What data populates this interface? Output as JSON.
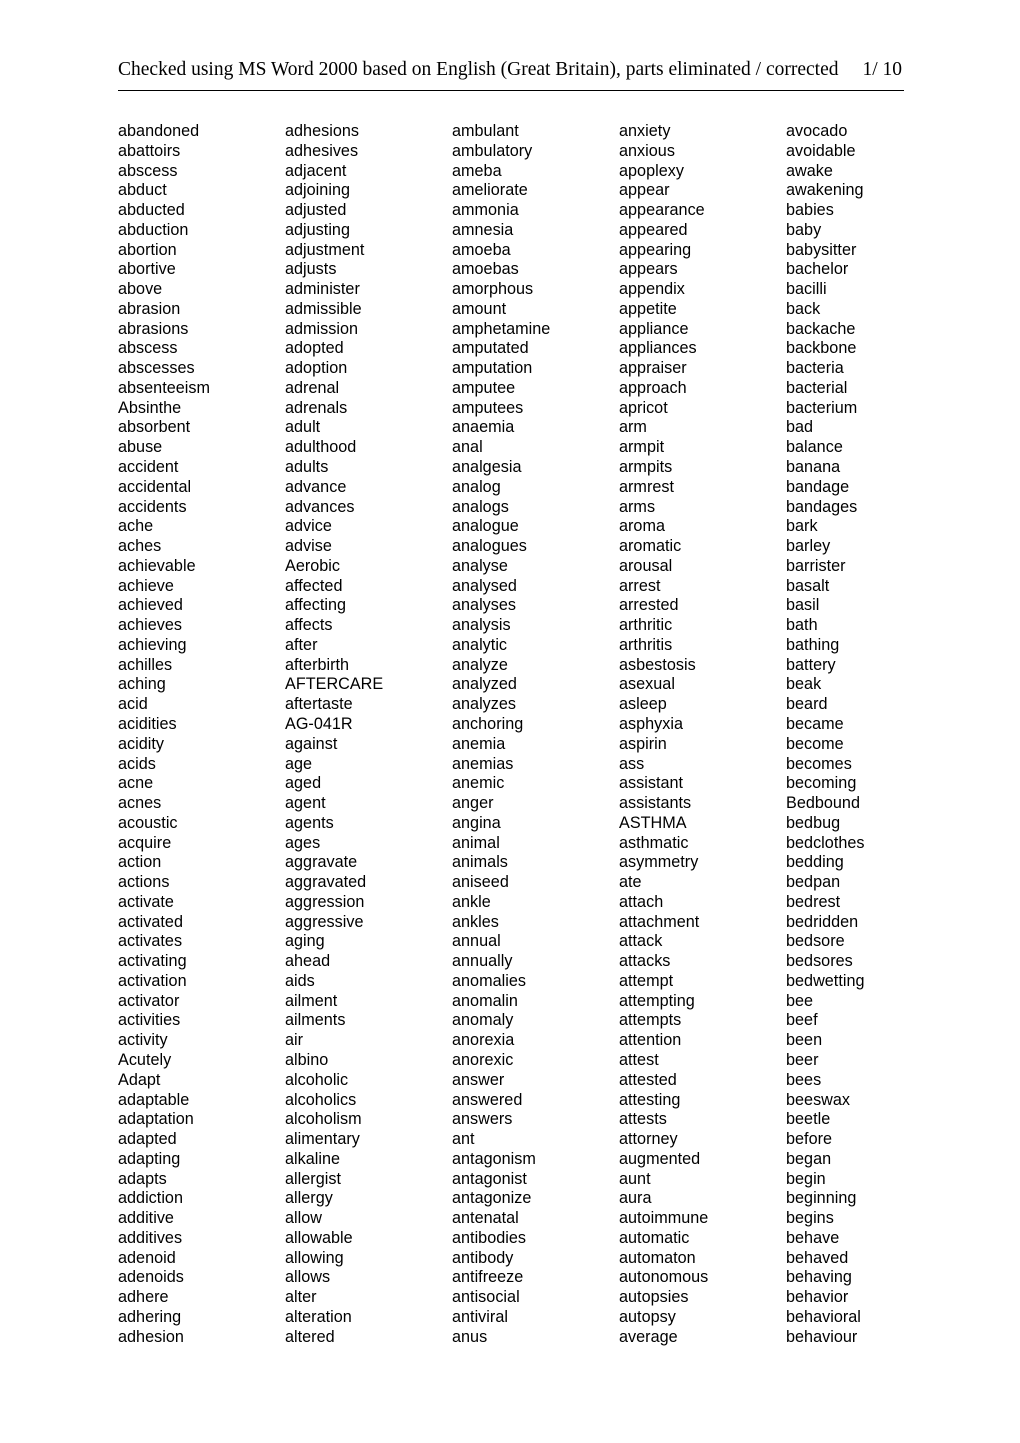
{
  "header": {
    "title": "Checked using MS Word 2000 based on English (Great Britain), parts eliminated / corrected",
    "page_number": "1/ 10"
  },
  "columns": [
    {
      "id": "column-1",
      "words": [
        "abandoned",
        "abattoirs",
        "abscess",
        "abduct",
        "abducted",
        "abduction",
        "abortion",
        "abortive",
        "above",
        "abrasion",
        "abrasions",
        "abscess",
        "abscesses",
        "absenteeism",
        "Absinthe",
        "absorbent",
        "abuse",
        "accident",
        "accidental",
        "accidents",
        "ache",
        "aches",
        "achievable",
        "achieve",
        "achieved",
        "achieves",
        "achieving",
        "achilles",
        "aching",
        "acid",
        "acidities",
        "acidity",
        "acids",
        "acne",
        "acnes",
        "acoustic",
        "acquire",
        "action",
        "actions",
        "activate",
        "activated",
        "activates",
        "activating",
        "activation",
        "activator",
        "activities",
        "activity",
        "Acutely",
        "Adapt",
        "adaptable",
        "adaptation",
        "adapted",
        "adapting",
        "adapts",
        "addiction",
        "additive",
        "additives",
        "adenoid",
        "adenoids",
        "adhere",
        "adhering",
        "adhesion"
      ]
    },
    {
      "id": "column-2",
      "words": [
        "adhesions",
        "adhesives",
        "adjacent",
        "adjoining",
        "adjusted",
        "adjusting",
        "adjustment",
        "adjusts",
        "administer",
        "admissible",
        "admission",
        "adopted",
        "adoption",
        "adrenal",
        "adrenals",
        "adult",
        "adulthood",
        "adults",
        "advance",
        "advances",
        "advice",
        "advise",
        "Aerobic",
        "affected",
        "affecting",
        "affects",
        "after",
        "afterbirth",
        "AFTERCARE",
        "aftertaste",
        "AG-041R",
        "against",
        "age",
        "aged",
        "agent",
        "agents",
        "ages",
        "aggravate",
        "aggravated",
        "aggression",
        "aggressive",
        "aging",
        "ahead",
        "aids",
        "ailment",
        "ailments",
        "air",
        "albino",
        "alcoholic",
        "alcoholics",
        "alcoholism",
        "alimentary",
        "alkaline",
        "allergist",
        "allergy",
        "allow",
        "allowable",
        "allowing",
        "allows",
        "alter",
        "alteration",
        "altered"
      ]
    },
    {
      "id": "column-3",
      "words": [
        "ambulant",
        "ambulatory",
        "ameba",
        "ameliorate",
        "ammonia",
        "amnesia",
        "amoeba",
        "amoebas",
        "amorphous",
        "amount",
        "amphetamine",
        "amputated",
        "amputation",
        "amputee",
        "amputees",
        "anaemia",
        "anal",
        "analgesia",
        "analog",
        "analogs",
        "analogue",
        "analogues",
        "analyse",
        "analysed",
        "analyses",
        "analysis",
        "analytic",
        "analyze",
        "analyzed",
        "analyzes",
        "anchoring",
        "anemia",
        "anemias",
        "anemic",
        "anger",
        "angina",
        "animal",
        "animals",
        "aniseed",
        "ankle",
        "ankles",
        "annual",
        "annually",
        "anomalies",
        "anomalin",
        "anomaly",
        "anorexia",
        "anorexic",
        "answer",
        "answered",
        "answers",
        "ant",
        "antagonism",
        "antagonist",
        "antagonize",
        "antenatal",
        "antibodies",
        "antibody",
        "antifreeze",
        "antisocial",
        "antiviral",
        "anus"
      ]
    },
    {
      "id": "column-4",
      "words": [
        "anxiety",
        "anxious",
        "apoplexy",
        "appear",
        "appearance",
        "appeared",
        "appearing",
        "appears",
        "appendix",
        "appetite",
        "appliance",
        "appliances",
        "appraiser",
        "approach",
        "apricot",
        "arm",
        "armpit",
        "armpits",
        "armrest",
        "arms",
        "aroma",
        "aromatic",
        "arousal",
        "arrest",
        "arrested",
        "arthritic",
        "arthritis",
        "asbestosis",
        "asexual",
        "asleep",
        "asphyxia",
        "aspirin",
        "ass",
        "assistant",
        "assistants",
        "ASTHMA",
        "asthmatic",
        "asymmetry",
        "ate",
        "attach",
        "attachment",
        "attack",
        "attacks",
        "attempt",
        "attempting",
        "attempts",
        "attention",
        "attest",
        "attested",
        "attesting",
        "attests",
        "attorney",
        "augmented",
        "aunt",
        "aura",
        "autoimmune",
        "automatic",
        "automaton",
        "autonomous",
        "autopsies",
        "autopsy",
        "average"
      ]
    },
    {
      "id": "column-5",
      "words": [
        "avocado",
        "avoidable",
        "awake",
        "awakening",
        "babies",
        "baby",
        "babysitter",
        "bachelor",
        "bacilli",
        "back",
        "backache",
        "backbone",
        "bacteria",
        "bacterial",
        "bacterium",
        "bad",
        "balance",
        "banana",
        "bandage",
        "bandages",
        "bark",
        "barley",
        "barrister",
        "basalt",
        "basil",
        "bath",
        "bathing",
        "battery",
        "beak",
        "beard",
        "became",
        "become",
        "becomes",
        "becoming",
        "Bedbound",
        "bedbug",
        "bedclothes",
        "bedding",
        "bedpan",
        "bedrest",
        "bedridden",
        "bedsore",
        "bedsores",
        "bedwetting",
        "bee",
        "beef",
        "been",
        "beer",
        "bees",
        "beeswax",
        "beetle",
        "before",
        "began",
        "begin",
        "beginning",
        "begins",
        "behave",
        "behaved",
        "behaving",
        "behavior",
        "behavioral",
        "behaviour"
      ]
    }
  ]
}
